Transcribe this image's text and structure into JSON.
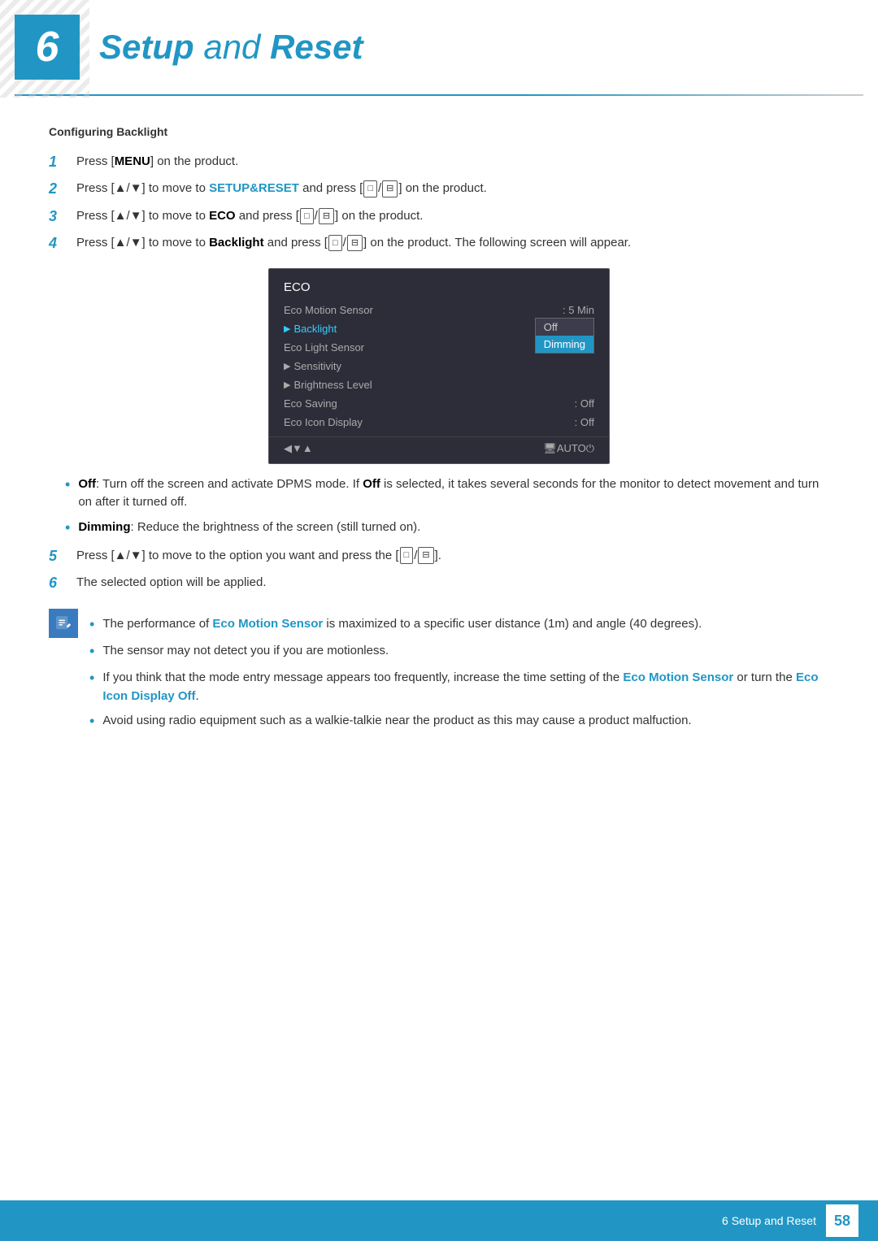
{
  "chapter": {
    "number": "6",
    "title": "Setup",
    "title_and": " and ",
    "title_reset": "Reset"
  },
  "section": {
    "heading": "Configuring Backlight"
  },
  "steps": [
    {
      "num": "1",
      "text": "Press [MENU] on the product."
    },
    {
      "num": "2",
      "text_before": "Press [▲/▼] to move to ",
      "bold": "SETUP&RESET",
      "text_after": " and press [□/⊟] on the product."
    },
    {
      "num": "3",
      "text_before": "Press [▲/▼] to move to ",
      "bold": "ECO",
      "text_after": " and press [□/⊟] on the product."
    },
    {
      "num": "4",
      "text_before": "Press [▲/▼] to move to ",
      "bold": "Backlight",
      "text_after": " and press [□/⊟] on the product. The following screen will appear."
    },
    {
      "num": "5",
      "text": "Press [▲/▼] to move to the option you want and press the [□/⊟]."
    },
    {
      "num": "6",
      "text": "The selected option will be applied."
    }
  ],
  "eco_menu": {
    "title": "ECO",
    "items": [
      {
        "label": "Eco Motion Sensor",
        "value": ": 5 Min",
        "arrow": false,
        "selected": false
      },
      {
        "label": "Backlight",
        "value": "",
        "arrow": true,
        "selected": true
      },
      {
        "label": "Eco Light Sensor",
        "value": "",
        "arrow": false,
        "selected": false
      },
      {
        "label": "Sensitivity",
        "value": "",
        "arrow": true,
        "selected": false
      },
      {
        "label": "Brightness Level",
        "value": "",
        "arrow": true,
        "selected": false
      },
      {
        "label": "Eco Saving",
        "value": ": Off",
        "arrow": false,
        "selected": false
      },
      {
        "label": "Eco Icon Display",
        "value": ": Off",
        "arrow": false,
        "selected": false
      }
    ],
    "dropdown": {
      "options": [
        "Off",
        "Dimming"
      ],
      "selected": 1
    }
  },
  "bullets": [
    {
      "bold": "Off",
      "text": ": Turn off the screen and activate DPMS mode. If Off is selected, it takes several seconds for the monitor to detect movement and turn on after it turned off."
    },
    {
      "bold": "Dimming",
      "text": ": Reduce the brightness of the screen (still turned on)."
    }
  ],
  "notes": [
    {
      "text_before": "The performance of ",
      "cyan_bold": "Eco Motion Sensor",
      "text_after": " is maximized to a specific user distance (1m) and angle (40 degrees)."
    },
    {
      "text": "The sensor may not detect you if you are motionless."
    },
    {
      "text_before": "If you think that the mode entry message appears too frequently, increase the time setting of the ",
      "cyan_bold": "Eco Motion Sensor",
      "text_mid": " or turn the ",
      "cyan_bold2": "Eco Icon Display Off",
      "text_after": "."
    },
    {
      "text": "Avoid using radio equipment such as a walkie-talkie near the product as this may cause a product malfuction."
    }
  ],
  "footer": {
    "text": "6 Setup and Reset",
    "page": "58"
  }
}
